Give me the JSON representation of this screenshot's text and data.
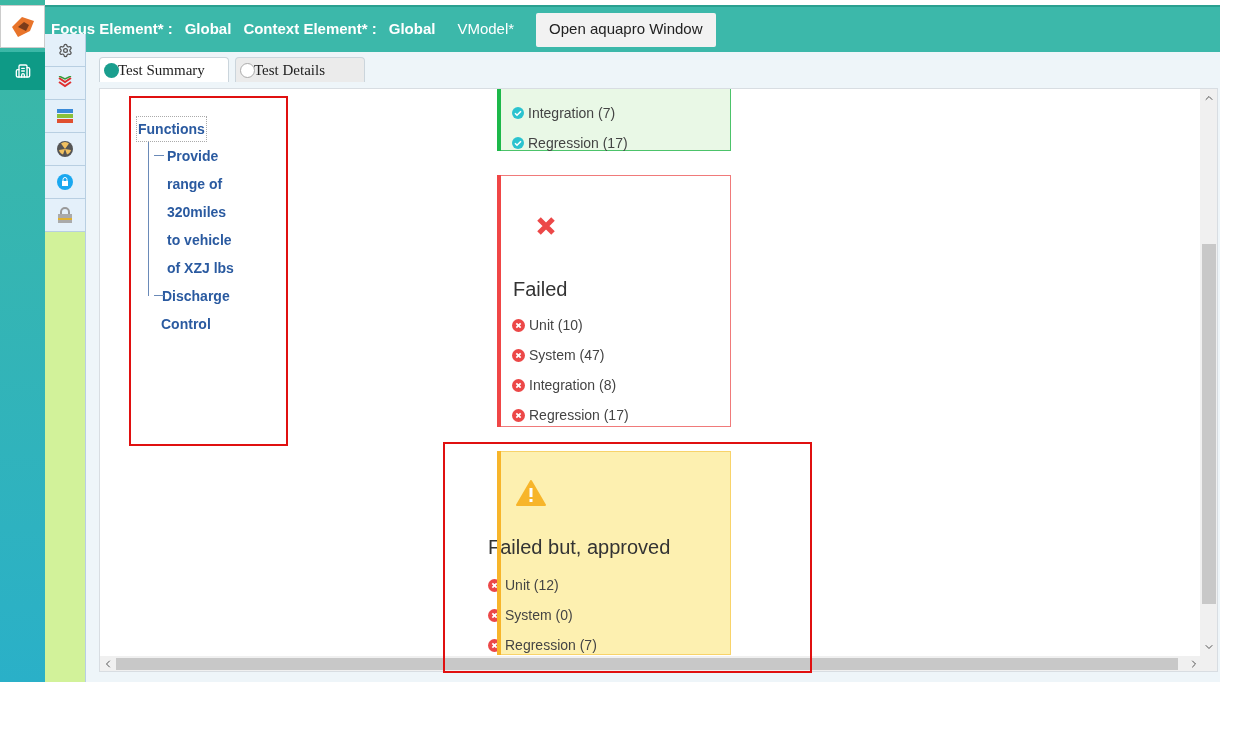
{
  "header": {
    "focus_label": "Focus Element* :",
    "focus_value": "Global",
    "context_label": "Context Element* :",
    "context_value": "Global",
    "model": "VModel*",
    "open_button": "Open aquapro Window"
  },
  "tabs": [
    {
      "label": "Test Summary",
      "selected": true
    },
    {
      "label": "Test Details",
      "selected": false
    }
  ],
  "tree": {
    "label": "Functions",
    "children": [
      {
        "label": "Provide range of 320miles to vehicle of XZJ lbs"
      },
      {
        "label": "Discharge Control"
      }
    ]
  },
  "cards": [
    {
      "kind": "passed",
      "items": [
        "Integration (7)",
        "Regression (17)"
      ]
    },
    {
      "kind": "failed",
      "title": "Failed",
      "items": [
        "Unit (10)",
        "System (47)",
        "Integration (8)",
        "Regression (17)"
      ]
    },
    {
      "kind": "approved",
      "title": "Failed but, approved",
      "items": [
        "Unit (12)",
        "System (0)",
        "Regression (7)"
      ]
    }
  ]
}
